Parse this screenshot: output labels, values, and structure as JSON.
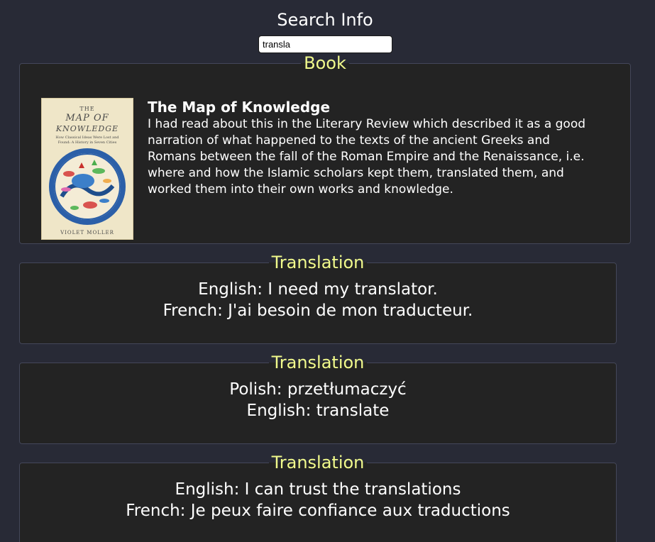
{
  "header": {
    "title": "Search Info"
  },
  "search": {
    "value": "transla"
  },
  "book_section": {
    "legend": "Book",
    "cover": {
      "line1": "THE",
      "line2": "MAP OF",
      "line3": "KNOWLEDGE",
      "subtitle": "How Classical Ideas Were Lost and Found: A History in Seven Cities",
      "author": "VIOLET MOLLER"
    },
    "title": "The Map of Knowledge",
    "description": "I had read about this in the Literary Review which described it as a good narration of what happened to the texts of the ancient Greeks and Romans between the fall of the Roman Empire and the Renaissance, i.e. where and how the Islamic scholars kept them, translated them, and worked them into their own works and knowledge."
  },
  "translations": [
    {
      "legend": "Translation",
      "line1": "English: I need my translator.",
      "line2": "French: J'ai besoin de mon traducteur."
    },
    {
      "legend": "Translation",
      "line1": "Polish: przetłumaczyć",
      "line2": "English: translate"
    },
    {
      "legend": "Translation",
      "line1": "English: I can trust the translations",
      "line2": "French: Je peux faire confiance aux traductions"
    }
  ]
}
